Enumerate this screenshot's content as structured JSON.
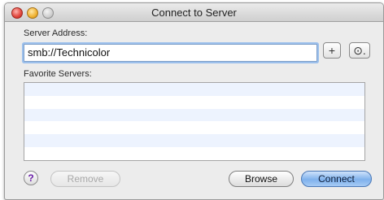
{
  "window": {
    "title": "Connect to Server"
  },
  "server_address": {
    "label": "Server Address:",
    "value": "smb://Technicolor"
  },
  "buttons": {
    "add_label": "+",
    "recent_label": "⊙.",
    "help_label": "?",
    "remove_label": "Remove",
    "browse_label": "Browse",
    "connect_label": "Connect"
  },
  "favorites": {
    "label": "Favorite Servers:",
    "rows": [
      "",
      "",
      "",
      "",
      "",
      ""
    ]
  },
  "colors": {
    "accent_blue": "#7fb1ec",
    "list_alt_row": "#edf3fe"
  }
}
